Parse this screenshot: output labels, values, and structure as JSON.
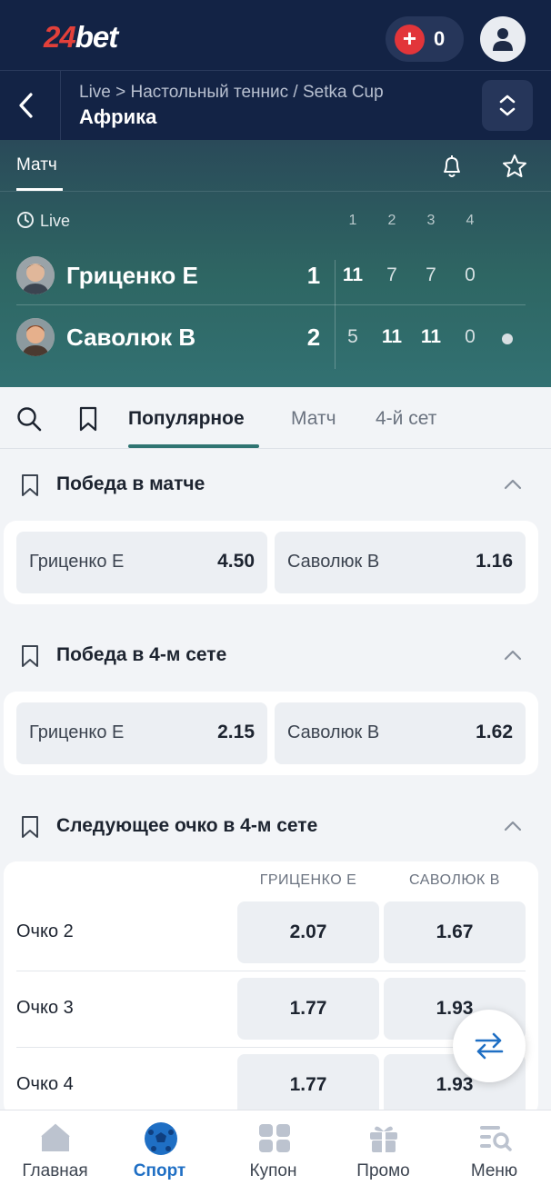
{
  "app": {
    "logo_num": "24",
    "logo_text": "bet",
    "balance": "0"
  },
  "header": {
    "breadcrumb": "Live > Настольный теннис / Setka Cup",
    "title": "Африка"
  },
  "scoreboard": {
    "tab": "Матч",
    "status": "Live",
    "set_headers": [
      "1",
      "2",
      "3",
      "4"
    ],
    "players": [
      {
        "name": "Гриценко Е",
        "total": "1",
        "sets": [
          "11",
          "7",
          "7",
          "0"
        ]
      },
      {
        "name": "Саволюк В",
        "total": "2",
        "sets": [
          "5",
          "11",
          "11",
          "0"
        ]
      }
    ]
  },
  "market_tabs": [
    "Популярное",
    "Матч",
    "4-й сет"
  ],
  "markets": [
    {
      "title": "Победа в матче",
      "odds": [
        {
          "label": "Гриценко Е",
          "value": "4.50"
        },
        {
          "label": "Саволюк В",
          "value": "1.16"
        }
      ]
    },
    {
      "title": "Победа в 4-м сете",
      "odds": [
        {
          "label": "Гриценко Е",
          "value": "2.15"
        },
        {
          "label": "Саволюк В",
          "value": "1.62"
        }
      ]
    }
  ],
  "next_point": {
    "title": "Следующее очко в 4-м сете",
    "columns": [
      "ГРИЦЕНКО Е",
      "САВОЛЮК В"
    ],
    "rows": [
      {
        "label": "Очко 2",
        "a": "2.07",
        "b": "1.67"
      },
      {
        "label": "Очко 3",
        "a": "1.77",
        "b": "1.93"
      },
      {
        "label": "Очко 4",
        "a": "1.77",
        "b": "1.93"
      }
    ]
  },
  "bottom_nav": [
    {
      "label": "Главная",
      "icon": "home-icon"
    },
    {
      "label": "Спорт",
      "icon": "soccer-ball-icon",
      "active": true
    },
    {
      "label": "Купон",
      "icon": "coupon-icon"
    },
    {
      "label": "Промо",
      "icon": "gift-icon"
    },
    {
      "label": "Меню",
      "icon": "menu-search-icon"
    }
  ],
  "colors": {
    "navy": "#132345",
    "accent_teal": "#2f7472",
    "active_blue": "#1f6fc4",
    "brand_red": "#e2403a"
  }
}
